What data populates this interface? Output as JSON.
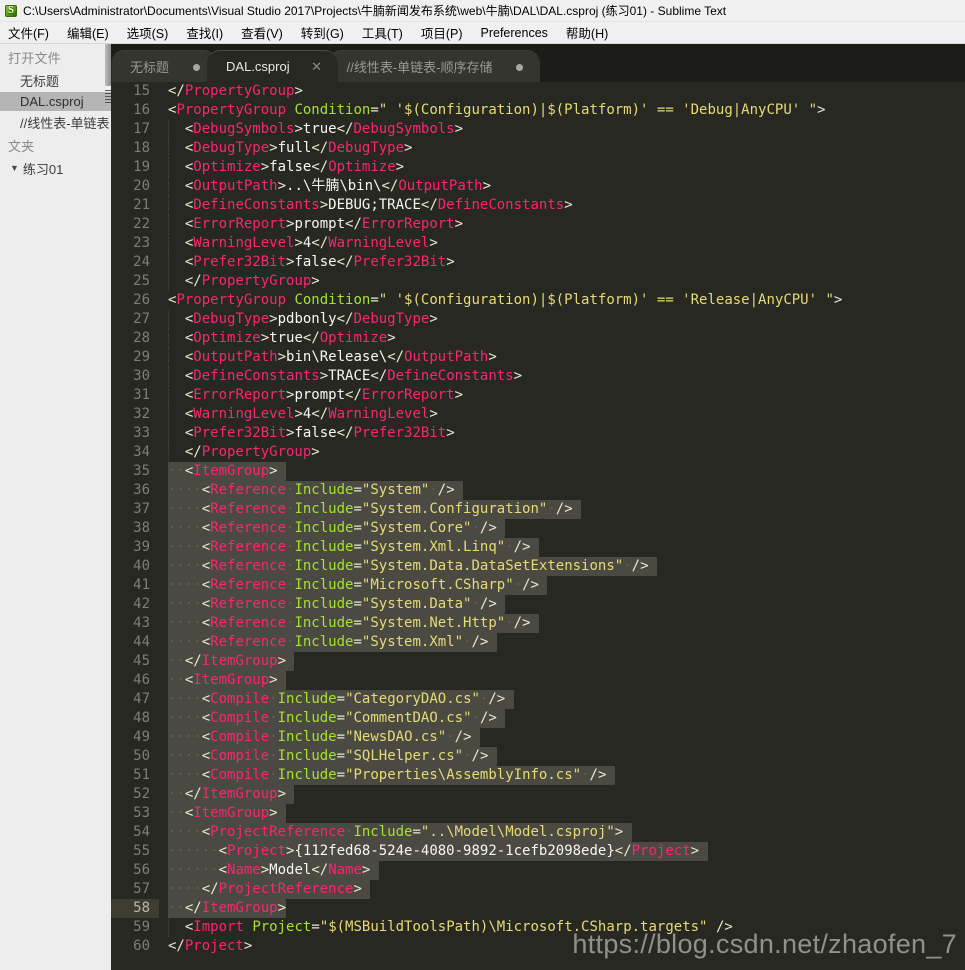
{
  "window": {
    "title": "C:\\Users\\Administrator\\Documents\\Visual Studio 2017\\Projects\\牛腩新闻发布系统\\web\\牛腩\\DAL\\DAL.csproj (练习01) - Sublime Text",
    "app_icon": "sublime-text-icon",
    "icon_glyph": "S"
  },
  "menubar": {
    "items": [
      {
        "label": "文件(F)"
      },
      {
        "label": "编辑(E)"
      },
      {
        "label": "选项(S)"
      },
      {
        "label": "查找(I)"
      },
      {
        "label": "查看(V)"
      },
      {
        "label": "转到(G)"
      },
      {
        "label": "工具(T)"
      },
      {
        "label": "项目(P)"
      },
      {
        "label": "Preferences"
      },
      {
        "label": "帮助(H)"
      }
    ]
  },
  "sidebar": {
    "open_files_header": "打开文件",
    "open_files": [
      {
        "label": "无标题",
        "selected": false
      },
      {
        "label": "DAL.csproj",
        "selected": true
      },
      {
        "label": "//线性表-单链表",
        "selected": false
      }
    ],
    "folders_header": "文夹",
    "folders": [
      {
        "label": "练习01",
        "expanded": true,
        "arrow": "▼"
      }
    ]
  },
  "tabs": [
    {
      "label": "无标题",
      "active": false,
      "indicator": "dirty-dot"
    },
    {
      "label": "DAL.csproj",
      "active": true,
      "indicator": "close-x",
      "close_glyph": "✕"
    },
    {
      "label": "//线性表-单链表-顺序存储",
      "active": false,
      "indicator": "dirty-dot"
    }
  ],
  "editor": {
    "first_line_number": 15,
    "active_line": 58,
    "selection_start_line": 35,
    "selection_end_line": 58,
    "lines": [
      {
        "n": 15,
        "html": "<span class=\"t-brk\">&lt;/</span><span class=\"t-tag\">PropertyGroup</span><span class=\"t-brk\">&gt;</span>",
        "indent_guide": false
      },
      {
        "n": 16,
        "html": "<span class=\"t-brk\">&lt;</span><span class=\"t-tag\">PropertyGroup</span> <span class=\"t-attr\">Condition</span><span class=\"t-brk\">=</span><span class=\"t-str\">\" '$(Configuration)|$(Platform)' == 'Debug|AnyCPU' \"</span><span class=\"t-brk\">&gt;</span>",
        "indent_guide": false
      },
      {
        "n": 17,
        "html": "  <span class=\"t-brk\">&lt;</span><span class=\"t-tag\">DebugSymbols</span><span class=\"t-brk\">&gt;</span><span class=\"t-txt\">true</span><span class=\"t-brk\">&lt;/</span><span class=\"t-tag\">DebugSymbols</span><span class=\"t-brk\">&gt;</span>",
        "indent_guide": true
      },
      {
        "n": 18,
        "html": "  <span class=\"t-brk\">&lt;</span><span class=\"t-tag\">DebugType</span><span class=\"t-brk\">&gt;</span><span class=\"t-txt\">full</span><span class=\"t-brk\">&lt;/</span><span class=\"t-tag\">DebugType</span><span class=\"t-brk\">&gt;</span>",
        "indent_guide": true
      },
      {
        "n": 19,
        "html": "  <span class=\"t-brk\">&lt;</span><span class=\"t-tag\">Optimize</span><span class=\"t-brk\">&gt;</span><span class=\"t-txt\">false</span><span class=\"t-brk\">&lt;/</span><span class=\"t-tag\">Optimize</span><span class=\"t-brk\">&gt;</span>",
        "indent_guide": true
      },
      {
        "n": 20,
        "html": "  <span class=\"t-brk\">&lt;</span><span class=\"t-tag\">OutputPath</span><span class=\"t-brk\">&gt;</span><span class=\"t-txt\">..\\牛腩\\bin\\</span><span class=\"t-brk\">&lt;/</span><span class=\"t-tag\">OutputPath</span><span class=\"t-brk\">&gt;</span>",
        "indent_guide": true
      },
      {
        "n": 21,
        "html": "  <span class=\"t-brk\">&lt;</span><span class=\"t-tag\">DefineConstants</span><span class=\"t-brk\">&gt;</span><span class=\"t-txt\">DEBUG;TRACE</span><span class=\"t-brk\">&lt;/</span><span class=\"t-tag\">DefineConstants</span><span class=\"t-brk\">&gt;</span>",
        "indent_guide": true
      },
      {
        "n": 22,
        "html": "  <span class=\"t-brk\">&lt;</span><span class=\"t-tag\">ErrorReport</span><span class=\"t-brk\">&gt;</span><span class=\"t-txt\">prompt</span><span class=\"t-brk\">&lt;/</span><span class=\"t-tag\">ErrorReport</span><span class=\"t-brk\">&gt;</span>",
        "indent_guide": true
      },
      {
        "n": 23,
        "html": "  <span class=\"t-brk\">&lt;</span><span class=\"t-tag\">WarningLevel</span><span class=\"t-brk\">&gt;</span><span class=\"t-txt\">4</span><span class=\"t-brk\">&lt;/</span><span class=\"t-tag\">WarningLevel</span><span class=\"t-brk\">&gt;</span>",
        "indent_guide": true
      },
      {
        "n": 24,
        "html": "  <span class=\"t-brk\">&lt;</span><span class=\"t-tag\">Prefer32Bit</span><span class=\"t-brk\">&gt;</span><span class=\"t-txt\">false</span><span class=\"t-brk\">&lt;/</span><span class=\"t-tag\">Prefer32Bit</span><span class=\"t-brk\">&gt;</span>",
        "indent_guide": true
      },
      {
        "n": 25,
        "html": "  <span class=\"t-brk\">&lt;/</span><span class=\"t-tag\">PropertyGroup</span><span class=\"t-brk\">&gt;</span>",
        "indent_guide": true
      },
      {
        "n": 26,
        "html": "<span class=\"t-brk\">&lt;</span><span class=\"t-tag\">PropertyGroup</span> <span class=\"t-attr\">Condition</span><span class=\"t-brk\">=</span><span class=\"t-str\">\" '$(Configuration)|$(Platform)' == 'Release|AnyCPU' \"</span><span class=\"t-brk\">&gt;</span>",
        "indent_guide": false
      },
      {
        "n": 27,
        "html": "  <span class=\"t-brk\">&lt;</span><span class=\"t-tag\">DebugType</span><span class=\"t-brk\">&gt;</span><span class=\"t-txt\">pdbonly</span><span class=\"t-brk\">&lt;/</span><span class=\"t-tag\">DebugType</span><span class=\"t-brk\">&gt;</span>",
        "indent_guide": true
      },
      {
        "n": 28,
        "html": "  <span class=\"t-brk\">&lt;</span><span class=\"t-tag\">Optimize</span><span class=\"t-brk\">&gt;</span><span class=\"t-txt\">true</span><span class=\"t-brk\">&lt;/</span><span class=\"t-tag\">Optimize</span><span class=\"t-brk\">&gt;</span>",
        "indent_guide": true
      },
      {
        "n": 29,
        "html": "  <span class=\"t-brk\">&lt;</span><span class=\"t-tag\">OutputPath</span><span class=\"t-brk\">&gt;</span><span class=\"t-txt\">bin\\Release\\</span><span class=\"t-brk\">&lt;/</span><span class=\"t-tag\">OutputPath</span><span class=\"t-brk\">&gt;</span>",
        "indent_guide": true
      },
      {
        "n": 30,
        "html": "  <span class=\"t-brk\">&lt;</span><span class=\"t-tag\">DefineConstants</span><span class=\"t-brk\">&gt;</span><span class=\"t-txt\">TRACE</span><span class=\"t-brk\">&lt;/</span><span class=\"t-tag\">DefineConstants</span><span class=\"t-brk\">&gt;</span>",
        "indent_guide": true
      },
      {
        "n": 31,
        "html": "  <span class=\"t-brk\">&lt;</span><span class=\"t-tag\">ErrorReport</span><span class=\"t-brk\">&gt;</span><span class=\"t-txt\">prompt</span><span class=\"t-brk\">&lt;/</span><span class=\"t-tag\">ErrorReport</span><span class=\"t-brk\">&gt;</span>",
        "indent_guide": true
      },
      {
        "n": 32,
        "html": "  <span class=\"t-brk\">&lt;</span><span class=\"t-tag\">WarningLevel</span><span class=\"t-brk\">&gt;</span><span class=\"t-txt\">4</span><span class=\"t-brk\">&lt;/</span><span class=\"t-tag\">WarningLevel</span><span class=\"t-brk\">&gt;</span>",
        "indent_guide": true
      },
      {
        "n": 33,
        "html": "  <span class=\"t-brk\">&lt;</span><span class=\"t-tag\">Prefer32Bit</span><span class=\"t-brk\">&gt;</span><span class=\"t-txt\">false</span><span class=\"t-brk\">&lt;/</span><span class=\"t-tag\">Prefer32Bit</span><span class=\"t-brk\">&gt;</span>",
        "indent_guide": true
      },
      {
        "n": 34,
        "html": "  <span class=\"t-brk\">&lt;/</span><span class=\"t-tag\">PropertyGroup</span><span class=\"t-brk\">&gt;</span>",
        "indent_guide": true
      },
      {
        "n": 35,
        "html": "<span class=\"sel\"><span class=\"t-ws\">··</span><span class=\"t-brk\">&lt;</span><span class=\"t-tag\">ItemGroup</span><span class=\"t-brk\">&gt;</span> </span>",
        "indent_guide": false
      },
      {
        "n": 36,
        "html": "<span class=\"sel\"><span class=\"t-ws\">····</span><span class=\"t-brk\">&lt;</span><span class=\"t-tag\">Reference</span><span class=\"t-ws\">·</span><span class=\"t-attr\">Include</span><span class=\"t-brk\">=</span><span class=\"t-str\">\"System\"</span><span class=\"t-ws\">·</span><span class=\"t-brk\">/&gt;</span> </span>",
        "indent_guide": true
      },
      {
        "n": 37,
        "html": "<span class=\"sel\"><span class=\"t-ws\">····</span><span class=\"t-brk\">&lt;</span><span class=\"t-tag\">Reference</span><span class=\"t-ws\">·</span><span class=\"t-attr\">Include</span><span class=\"t-brk\">=</span><span class=\"t-str\">\"System.Configuration\"</span><span class=\"t-ws\">·</span><span class=\"t-brk\">/&gt;</span> </span>",
        "indent_guide": true
      },
      {
        "n": 38,
        "html": "<span class=\"sel\"><span class=\"t-ws\">····</span><span class=\"t-brk\">&lt;</span><span class=\"t-tag\">Reference</span><span class=\"t-ws\">·</span><span class=\"t-attr\">Include</span><span class=\"t-brk\">=</span><span class=\"t-str\">\"System.Core\"</span><span class=\"t-ws\">·</span><span class=\"t-brk\">/&gt;</span> </span>",
        "indent_guide": true
      },
      {
        "n": 39,
        "html": "<span class=\"sel\"><span class=\"t-ws\">····</span><span class=\"t-brk\">&lt;</span><span class=\"t-tag\">Reference</span><span class=\"t-ws\">·</span><span class=\"t-attr\">Include</span><span class=\"t-brk\">=</span><span class=\"t-str\">\"System.Xml.Linq\"</span><span class=\"t-ws\">·</span><span class=\"t-brk\">/&gt;</span> </span>",
        "indent_guide": true
      },
      {
        "n": 40,
        "html": "<span class=\"sel\"><span class=\"t-ws\">····</span><span class=\"t-brk\">&lt;</span><span class=\"t-tag\">Reference</span><span class=\"t-ws\">·</span><span class=\"t-attr\">Include</span><span class=\"t-brk\">=</span><span class=\"t-str\">\"System.Data.DataSetExtensions\"</span><span class=\"t-ws\">·</span><span class=\"t-brk\">/&gt;</span> </span>",
        "indent_guide": true
      },
      {
        "n": 41,
        "html": "<span class=\"sel\"><span class=\"t-ws\">····</span><span class=\"t-brk\">&lt;</span><span class=\"t-tag\">Reference</span><span class=\"t-ws\">·</span><span class=\"t-attr\">Include</span><span class=\"t-brk\">=</span><span class=\"t-str\">\"Microsoft.CSharp\"</span><span class=\"t-ws\">·</span><span class=\"t-brk\">/&gt;</span> </span>",
        "indent_guide": true
      },
      {
        "n": 42,
        "html": "<span class=\"sel\"><span class=\"t-ws\">····</span><span class=\"t-brk\">&lt;</span><span class=\"t-tag\">Reference</span><span class=\"t-ws\">·</span><span class=\"t-attr\">Include</span><span class=\"t-brk\">=</span><span class=\"t-str\">\"System.Data\"</span><span class=\"t-ws\">·</span><span class=\"t-brk\">/&gt;</span> </span>",
        "indent_guide": true
      },
      {
        "n": 43,
        "html": "<span class=\"sel\"><span class=\"t-ws\">····</span><span class=\"t-brk\">&lt;</span><span class=\"t-tag\">Reference</span><span class=\"t-ws\">·</span><span class=\"t-attr\">Include</span><span class=\"t-brk\">=</span><span class=\"t-str\">\"System.Net.Http\"</span><span class=\"t-ws\">·</span><span class=\"t-brk\">/&gt;</span> </span>",
        "indent_guide": true
      },
      {
        "n": 44,
        "html": "<span class=\"sel\"><span class=\"t-ws\">····</span><span class=\"t-brk\">&lt;</span><span class=\"t-tag\">Reference</span><span class=\"t-ws\">·</span><span class=\"t-attr\">Include</span><span class=\"t-brk\">=</span><span class=\"t-str\">\"System.Xml\"</span><span class=\"t-ws\">·</span><span class=\"t-brk\">/&gt;</span> </span>",
        "indent_guide": true
      },
      {
        "n": 45,
        "html": "<span class=\"sel\"><span class=\"t-ws\">··</span><span class=\"t-brk\">&lt;/</span><span class=\"t-tag\">ItemGroup</span><span class=\"t-brk\">&gt;</span> </span>",
        "indent_guide": false
      },
      {
        "n": 46,
        "html": "<span class=\"sel\"><span class=\"t-ws\">··</span><span class=\"t-brk\">&lt;</span><span class=\"t-tag\">ItemGroup</span><span class=\"t-brk\">&gt;</span> </span>",
        "indent_guide": false
      },
      {
        "n": 47,
        "html": "<span class=\"sel\"><span class=\"t-ws\">····</span><span class=\"t-brk\">&lt;</span><span class=\"t-tag\">Compile</span><span class=\"t-ws\">·</span><span class=\"t-attr\">Include</span><span class=\"t-brk\">=</span><span class=\"t-str\">\"CategoryDAO.cs\"</span><span class=\"t-ws\">·</span><span class=\"t-brk\">/&gt;</span> </span>",
        "indent_guide": true
      },
      {
        "n": 48,
        "html": "<span class=\"sel\"><span class=\"t-ws\">····</span><span class=\"t-brk\">&lt;</span><span class=\"t-tag\">Compile</span><span class=\"t-ws\">·</span><span class=\"t-attr\">Include</span><span class=\"t-brk\">=</span><span class=\"t-str\">\"CommentDAO.cs\"</span><span class=\"t-ws\">·</span><span class=\"t-brk\">/&gt;</span> </span>",
        "indent_guide": true
      },
      {
        "n": 49,
        "html": "<span class=\"sel\"><span class=\"t-ws\">····</span><span class=\"t-brk\">&lt;</span><span class=\"t-tag\">Compile</span><span class=\"t-ws\">·</span><span class=\"t-attr\">Include</span><span class=\"t-brk\">=</span><span class=\"t-str\">\"NewsDAO.cs\"</span><span class=\"t-ws\">·</span><span class=\"t-brk\">/&gt;</span> </span>",
        "indent_guide": true
      },
      {
        "n": 50,
        "html": "<span class=\"sel\"><span class=\"t-ws\">····</span><span class=\"t-brk\">&lt;</span><span class=\"t-tag\">Compile</span><span class=\"t-ws\">·</span><span class=\"t-attr\">Include</span><span class=\"t-brk\">=</span><span class=\"t-str\">\"SQLHelper.cs\"</span><span class=\"t-ws\">·</span><span class=\"t-brk\">/&gt;</span> </span>",
        "indent_guide": true
      },
      {
        "n": 51,
        "html": "<span class=\"sel\"><span class=\"t-ws\">····</span><span class=\"t-brk\">&lt;</span><span class=\"t-tag\">Compile</span><span class=\"t-ws\">·</span><span class=\"t-attr\">Include</span><span class=\"t-brk\">=</span><span class=\"t-str\">\"Properties\\AssemblyInfo.cs\"</span><span class=\"t-ws\">·</span><span class=\"t-brk\">/&gt;</span> </span>",
        "indent_guide": true
      },
      {
        "n": 52,
        "html": "<span class=\"sel\"><span class=\"t-ws\">··</span><span class=\"t-brk\">&lt;/</span><span class=\"t-tag\">ItemGroup</span><span class=\"t-brk\">&gt;</span> </span>",
        "indent_guide": false
      },
      {
        "n": 53,
        "html": "<span class=\"sel\"><span class=\"t-ws\">··</span><span class=\"t-brk\">&lt;</span><span class=\"t-tag\">ItemGroup</span><span class=\"t-brk\">&gt;</span> </span>",
        "indent_guide": false
      },
      {
        "n": 54,
        "html": "<span class=\"sel\"><span class=\"t-ws\">····</span><span class=\"t-brk\">&lt;</span><span class=\"t-tag\">ProjectReference</span><span class=\"t-ws\">·</span><span class=\"t-attr\">Include</span><span class=\"t-brk\">=</span><span class=\"t-str\">\"..\\Model\\Model.csproj\"</span><span class=\"t-brk\">&gt;</span> </span>",
        "indent_guide": true
      },
      {
        "n": 55,
        "html": "<span class=\"sel\"><span class=\"t-ws\">······</span><span class=\"t-brk\">&lt;</span><span class=\"t-tag\">Project</span><span class=\"t-brk\">&gt;</span><span class=\"t-txt\">{112fed68-524e-4080-9892-1cefb2098ede}</span><span class=\"t-brk\">&lt;/</span><span class=\"t-tag\">Project</span><span class=\"t-brk\">&gt;</span> </span>",
        "indent_guide": true
      },
      {
        "n": 56,
        "html": "<span class=\"sel\"><span class=\"t-ws\">······</span><span class=\"t-brk\">&lt;</span><span class=\"t-tag\">Name</span><span class=\"t-brk\">&gt;</span><span class=\"t-txt\">Model</span><span class=\"t-brk\">&lt;/</span><span class=\"t-tag\">Name</span><span class=\"t-brk\">&gt;</span> </span>",
        "indent_guide": true
      },
      {
        "n": 57,
        "html": "<span class=\"sel\"><span class=\"t-ws\">····</span><span class=\"t-brk\">&lt;/</span><span class=\"t-tag\">ProjectReference</span><span class=\"t-brk\">&gt;</span> </span>",
        "indent_guide": true
      },
      {
        "n": 58,
        "html": "<span class=\"sel\"><span class=\"t-ws\">··</span><span class=\"t-brk\">&lt;/</span><span class=\"t-tag\">ItemGroup</span><span class=\"t-brk\">&gt;</span></span>",
        "indent_guide": false
      },
      {
        "n": 59,
        "html": "  <span class=\"t-brk\">&lt;</span><span class=\"t-tag\">Import</span> <span class=\"t-attr\">Project</span><span class=\"t-brk\">=</span><span class=\"t-str\">\"$(MSBuildToolsPath)\\Microsoft.CSharp.targets\"</span> <span class=\"t-brk\">/&gt;</span>",
        "indent_guide": true
      },
      {
        "n": 60,
        "html": "<span class=\"t-brk\">&lt;/</span><span class=\"t-tag\">Project</span><span class=\"t-brk\">&gt;</span>",
        "indent_guide": false
      }
    ]
  },
  "watermark": {
    "text": "https://blog.csdn.net/zhaofen_7"
  },
  "colors": {
    "editor_bg": "#272822",
    "tag": "#f92672",
    "attribute": "#a6e22e",
    "string": "#e6db74",
    "text": "#f8f8f2",
    "selection": "#4a4a42",
    "gutter_text": "#7d7f74",
    "sidebar_bg": "#ededed",
    "tabbar_bg": "#1c1d18",
    "active_line_gutter": "#3e3d32"
  }
}
